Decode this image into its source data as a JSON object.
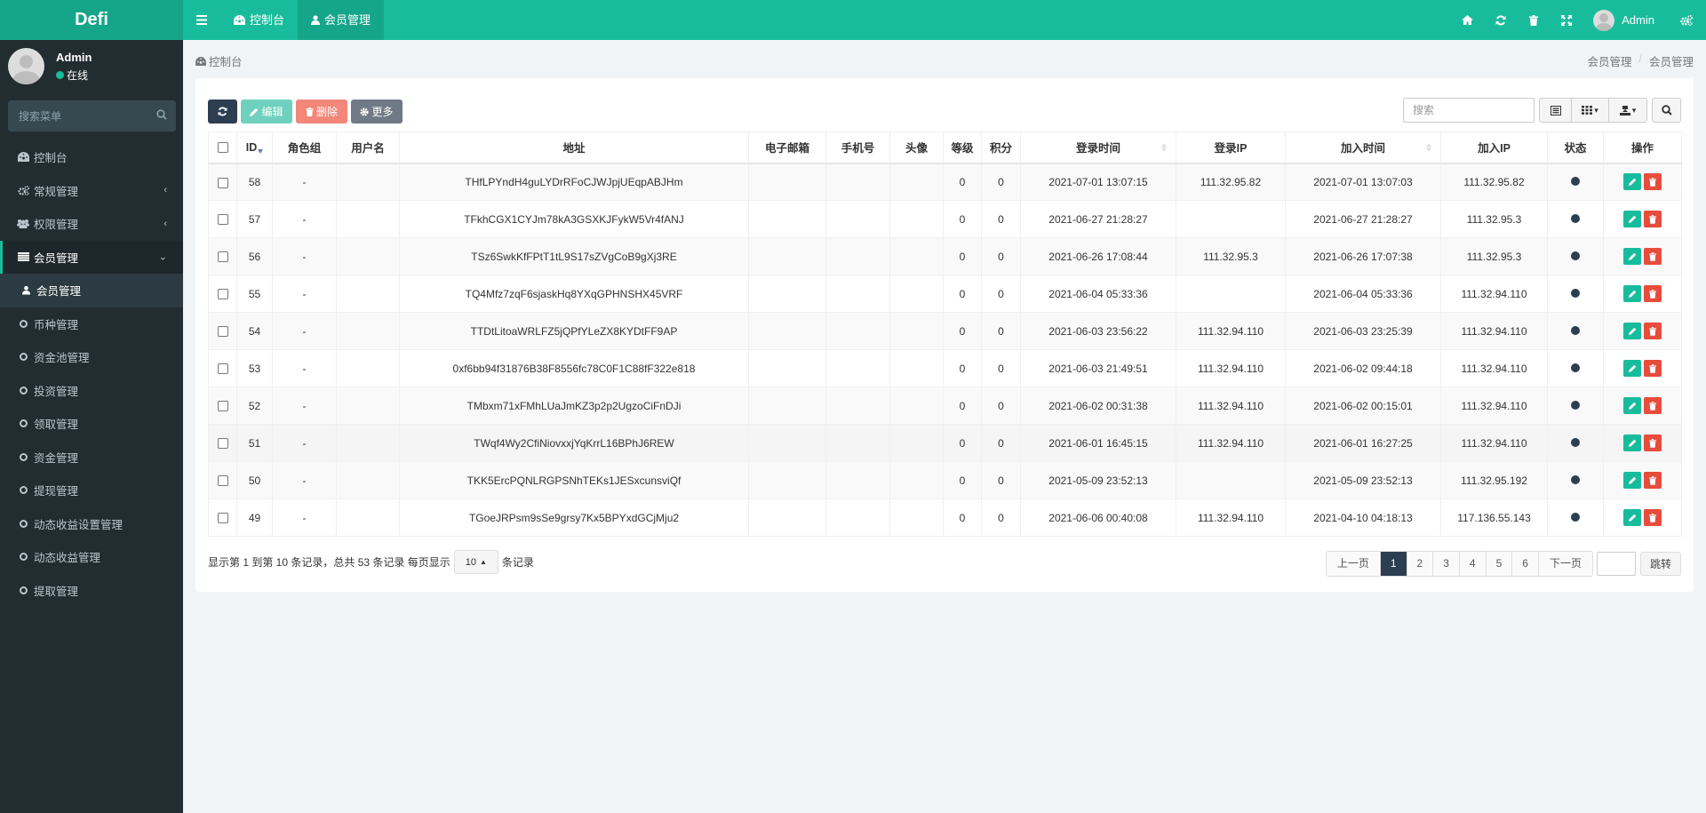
{
  "app": {
    "logo": "Defi",
    "colors": {
      "primary": "#18bc9c",
      "sidebar": "#222d32",
      "danger": "#e74c3c",
      "dark": "#2c3e50",
      "link": "#3c8dbc"
    }
  },
  "header": {
    "menu_toggle_icon": "bars-icon",
    "tabs": [
      {
        "label": "控制台",
        "icon": "dashboard-icon",
        "active": false
      },
      {
        "label": "会员管理",
        "icon": "user-icon",
        "active": true
      }
    ],
    "right_icons": [
      "home-icon",
      "refresh-icon",
      "trash-icon",
      "fullscreen-icon"
    ],
    "user_name": "Admin",
    "settings_icon": "cogs-icon"
  },
  "sidebar": {
    "user_name": "Admin",
    "status": "在线",
    "search_placeholder": "搜索菜单",
    "items": [
      {
        "label": "控制台",
        "icon": "dashboard-icon"
      },
      {
        "label": "常规管理",
        "icon": "cogs-icon",
        "has_children": true
      },
      {
        "label": "权限管理",
        "icon": "group-icon",
        "has_children": true
      },
      {
        "label": "会员管理",
        "icon": "list-icon",
        "expanded": true
      },
      {
        "label": "会员管理",
        "icon": "user-icon",
        "active": true
      },
      {
        "label": "币种管理",
        "icon": "circle-o-icon"
      },
      {
        "label": "资金池管理",
        "icon": "circle-o-icon"
      },
      {
        "label": "投资管理",
        "icon": "circle-o-icon"
      },
      {
        "label": "领取管理",
        "icon": "circle-o-icon"
      },
      {
        "label": "资金管理",
        "icon": "circle-o-icon"
      },
      {
        "label": "提现管理",
        "icon": "circle-o-icon"
      },
      {
        "label": "动态收益设置管理",
        "icon": "circle-o-icon"
      },
      {
        "label": "动态收益管理",
        "icon": "circle-o-icon"
      },
      {
        "label": "提取管理",
        "icon": "circle-o-icon"
      }
    ]
  },
  "breadcrumb": {
    "left": "控制台",
    "right": [
      "会员管理",
      "会员管理"
    ]
  },
  "toolbar": {
    "refresh_icon": "refresh-icon",
    "edit_label": "编辑",
    "delete_label": "删除",
    "more_label": "更多",
    "search_placeholder": "搜索"
  },
  "table": {
    "columns": [
      "ID",
      "角色组",
      "用户名",
      "地址",
      "电子邮箱",
      "手机号",
      "头像",
      "等级",
      "积分",
      "登录时间",
      "登录IP",
      "加入时间",
      "加入IP",
      "状态",
      "操作"
    ],
    "rows": [
      {
        "id": "58",
        "group": "-",
        "username": "",
        "address": "THfLPYndH4guLYDrRFoCJWJpjUEqpABJHm",
        "email": "",
        "mobile": "",
        "avatar": "",
        "level": "0",
        "score": "0",
        "login_time": "2021-07-01 13:07:15",
        "login_ip": "111.32.95.82",
        "join_time": "2021-07-01 13:07:03",
        "join_ip": "111.32.95.82",
        "status": "normal"
      },
      {
        "id": "57",
        "group": "-",
        "username": "",
        "address": "TFkhCGX1CYJm78kA3GSXKJFykW5Vr4fANJ",
        "email": "",
        "mobile": "",
        "avatar": "",
        "level": "0",
        "score": "0",
        "login_time": "2021-06-27 21:28:27",
        "login_ip": "",
        "join_time": "2021-06-27 21:28:27",
        "join_ip": "111.32.95.3",
        "status": "normal"
      },
      {
        "id": "56",
        "group": "-",
        "username": "",
        "address": "TSz6SwkKfFPtT1tL9S17sZVgCoB9gXj3RE",
        "email": "",
        "mobile": "",
        "avatar": "",
        "level": "0",
        "score": "0",
        "login_time": "2021-06-26 17:08:44",
        "login_ip": "111.32.95.3",
        "join_time": "2021-06-26 17:07:38",
        "join_ip": "111.32.95.3",
        "status": "normal"
      },
      {
        "id": "55",
        "group": "-",
        "username": "",
        "address": "TQ4Mfz7zqF6sjaskHq8YXqGPHNSHX45VRF",
        "email": "",
        "mobile": "",
        "avatar": "",
        "level": "0",
        "score": "0",
        "login_time": "2021-06-04 05:33:36",
        "login_ip": "",
        "join_time": "2021-06-04 05:33:36",
        "join_ip": "111.32.94.110",
        "status": "normal"
      },
      {
        "id": "54",
        "group": "-",
        "username": "",
        "address": "TTDtLitoaWRLFZ5jQPfYLeZX8KYDtFF9AP",
        "email": "",
        "mobile": "",
        "avatar": "",
        "level": "0",
        "score": "0",
        "login_time": "2021-06-03 23:56:22",
        "login_ip": "111.32.94.110",
        "join_time": "2021-06-03 23:25:39",
        "join_ip": "111.32.94.110",
        "status": "normal"
      },
      {
        "id": "53",
        "group": "-",
        "username": "",
        "address": "0xf6bb94f31876B38F8556fc78C0F1C88fF322e818",
        "email": "",
        "mobile": "",
        "avatar": "",
        "level": "0",
        "score": "0",
        "login_time": "2021-06-03 21:49:51",
        "login_ip": "111.32.94.110",
        "join_time": "2021-06-02 09:44:18",
        "join_ip": "111.32.94.110",
        "status": "normal"
      },
      {
        "id": "52",
        "group": "-",
        "username": "",
        "address": "TMbxm71xFMhLUaJmKZ3p2p2UgzoCiFnDJi",
        "email": "",
        "mobile": "",
        "avatar": "",
        "level": "0",
        "score": "0",
        "login_time": "2021-06-02 00:31:38",
        "login_ip": "111.32.94.110",
        "join_time": "2021-06-02 00:15:01",
        "join_ip": "111.32.94.110",
        "status": "normal"
      },
      {
        "id": "51",
        "group": "-",
        "username": "",
        "address": "TWqf4Wy2CfiNiovxxjYqKrrL16BPhJ6REW",
        "email": "",
        "mobile": "",
        "avatar": "",
        "level": "0",
        "score": "0",
        "login_time": "2021-06-01 16:45:15",
        "login_ip": "111.32.94.110",
        "join_time": "2021-06-01 16:27:25",
        "join_ip": "111.32.94.110",
        "status": "normal"
      },
      {
        "id": "50",
        "group": "-",
        "username": "",
        "address": "TKK5ErcPQNLRGPSNhTEKs1JESxcunsviQf",
        "email": "",
        "mobile": "",
        "avatar": "",
        "level": "0",
        "score": "0",
        "login_time": "2021-05-09 23:52:13",
        "login_ip": "",
        "join_time": "2021-05-09 23:52:13",
        "join_ip": "111.32.95.192",
        "status": "normal"
      },
      {
        "id": "49",
        "group": "-",
        "username": "",
        "address": "TGoeJRPsm9sSe9grsy7Kx5BPYxdGCjMju2",
        "email": "",
        "mobile": "",
        "avatar": "",
        "level": "0",
        "score": "0",
        "login_time": "2021-06-06 00:40:08",
        "login_ip": "111.32.94.110",
        "join_time": "2021-04-10 04:18:13",
        "join_ip": "117.136.55.143",
        "status": "normal"
      }
    ]
  },
  "pagination": {
    "info_prefix": "显示第 1 到第 10 条记录，总共 53 条记录 每页显示",
    "page_size": "10",
    "info_suffix": "条记录",
    "prev": "上一页",
    "pages": [
      "1",
      "2",
      "3",
      "4",
      "5",
      "6"
    ],
    "current": "1",
    "next": "下一页",
    "jump_value": "",
    "jump_label": "跳转"
  }
}
